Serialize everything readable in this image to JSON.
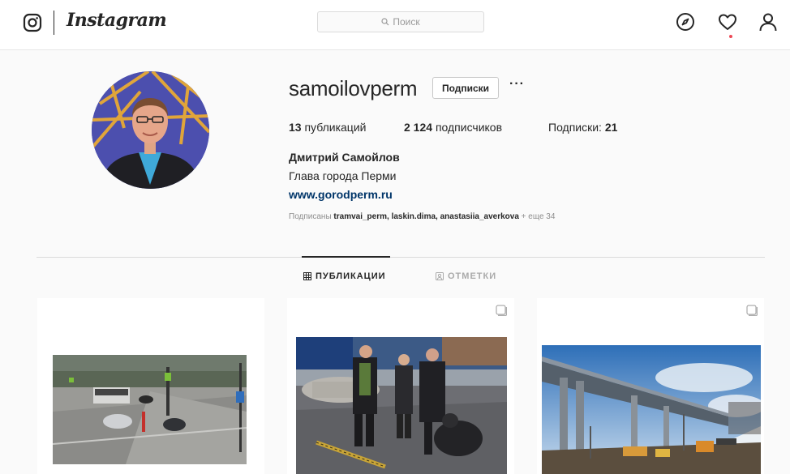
{
  "header": {
    "logo_text": "Instagram",
    "search_placeholder": "Поиск",
    "icons": [
      "instagram-camera-icon",
      "search-icon",
      "compass-icon",
      "heart-icon",
      "user-icon"
    ],
    "notification_dot_color": "#ed4956"
  },
  "profile": {
    "username": "samoilovperm",
    "follow_button_label": "Подписки",
    "more_label": "···",
    "stats": {
      "posts_count": "13",
      "posts_label": "публикаций",
      "followers_count": "2 124",
      "followers_label": "подписчиков",
      "following_label": "Подписки:",
      "following_count": "21"
    },
    "full_name": "Дмитрий Самойлов",
    "bio": "Глава города Перми",
    "website": "www.gorodperm.ru",
    "followed_by_label": "Подписаны",
    "followed_by_names": "tramvai_perm, laskin.dima, anastasiia_averkova",
    "followed_by_more": "+ еще 34"
  },
  "tabs": [
    {
      "label": "ПУБЛИКАЦИИ",
      "icon": "grid-icon",
      "active": true
    },
    {
      "label": "ОТМЕТКИ",
      "icon": "tag-icon",
      "active": false
    }
  ],
  "posts": [
    {
      "subject": "street-intersection-photo",
      "multi": false
    },
    {
      "subject": "people-inspecting-asphalt-photo",
      "multi": true
    },
    {
      "subject": "bridge-construction-photo",
      "multi": true
    }
  ],
  "colors": {
    "link": "#003569",
    "text": "#262626",
    "muted": "#8e8e8e",
    "border": "#dbdbdb",
    "background": "#fafafa"
  }
}
